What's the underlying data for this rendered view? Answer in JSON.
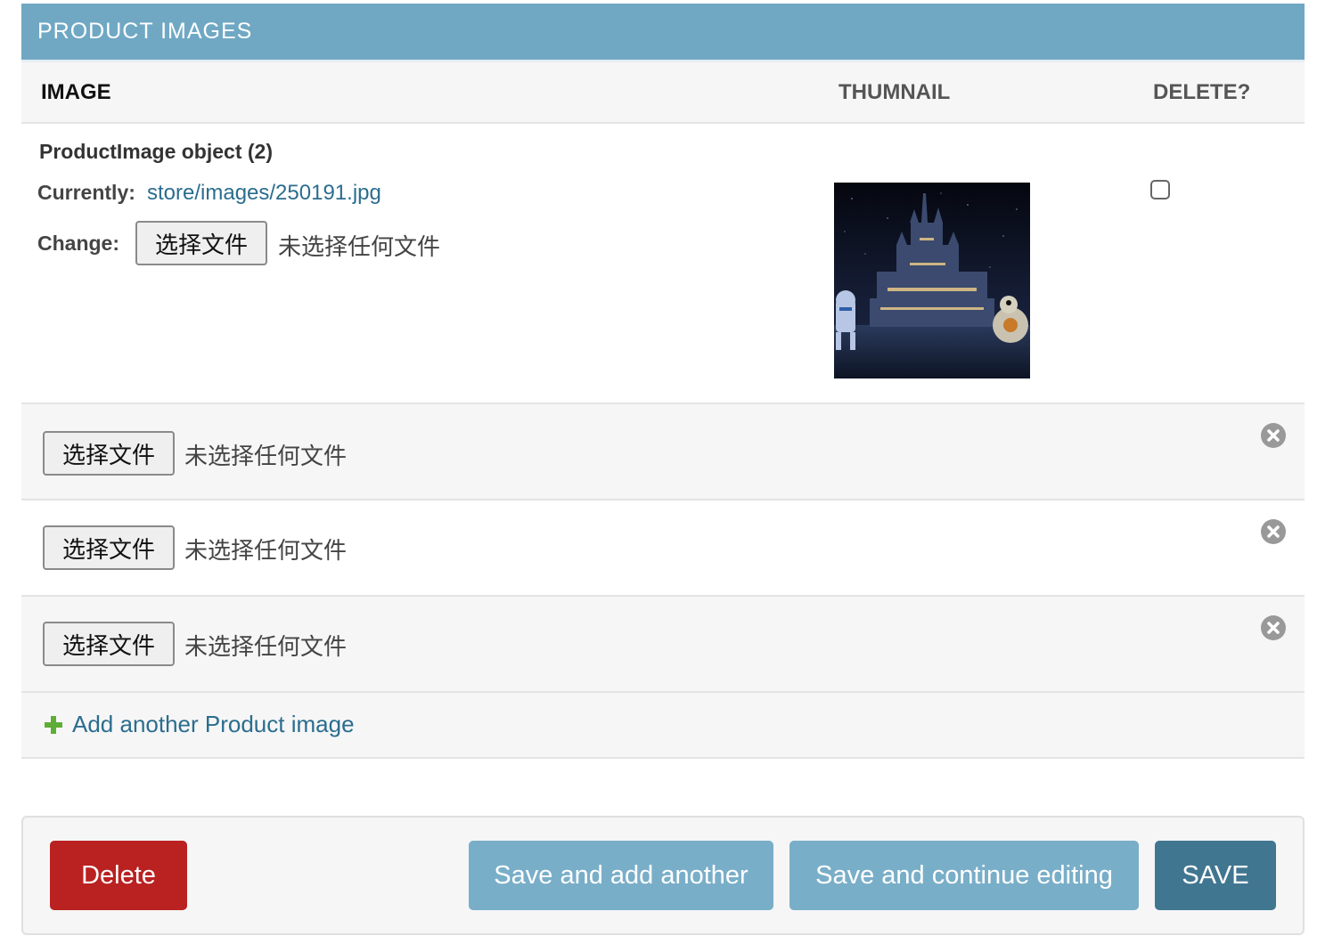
{
  "inline": {
    "caption": "PRODUCT IMAGES",
    "headers": {
      "image": "IMAGE",
      "thumbnail": "THUMNAIL",
      "delete": "DELETE?"
    },
    "existing": {
      "title": "ProductImage object (2)",
      "currently_label": "Currently:",
      "currently_value": "store/images/250191.jpg",
      "change_label": "Change:",
      "choose_label": "选择文件",
      "no_file": "未选择任何文件",
      "delete_checked": false
    },
    "extra_rows": [
      {
        "choose_label": "选择文件",
        "no_file": "未选择任何文件"
      },
      {
        "choose_label": "选择文件",
        "no_file": "未选择任何文件"
      },
      {
        "choose_label": "选择文件",
        "no_file": "未选择任何文件"
      }
    ],
    "add_another": "Add another Product image"
  },
  "submit": {
    "delete": "Delete",
    "save_add_another": "Save and add another",
    "save_continue": "Save and continue editing",
    "save": "SAVE"
  },
  "colors": {
    "caption_bg": "#70a8c4",
    "link": "#2b6d8f",
    "delete_btn": "#ba2121",
    "secondary_btn": "#79aec8",
    "primary_btn": "#417690",
    "add_icon": "#5fad36",
    "remove_icon": "#999999"
  },
  "icons": {
    "remove": "remove-circle-icon",
    "add": "plus-icon"
  }
}
